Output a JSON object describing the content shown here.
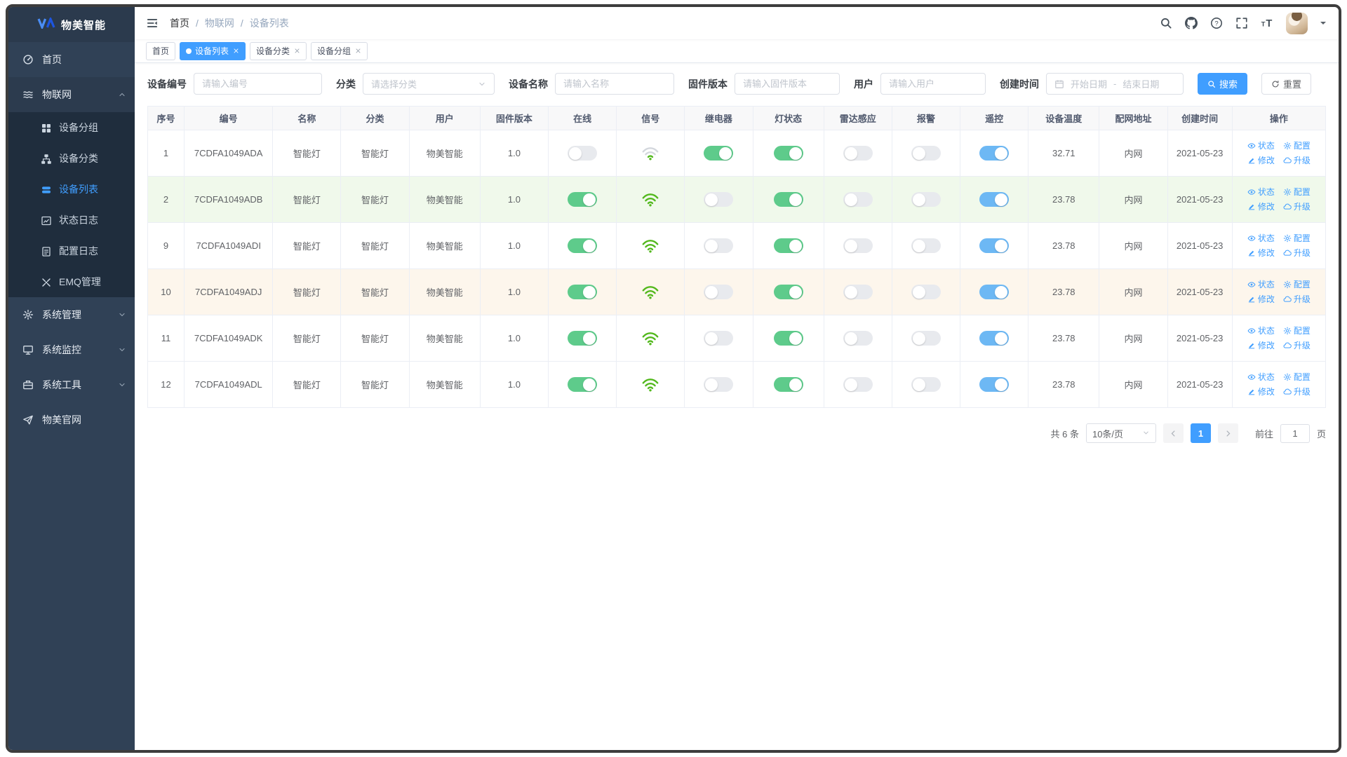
{
  "app": {
    "brand": "物美智能"
  },
  "colors": {
    "accent": "#409EFF",
    "toggle_green": "#5ecb8b",
    "toggle_blue": "#6db8f4",
    "wifi_green": "#52b81c",
    "row_green": "#f0f9eb",
    "row_orange": "#fdf6ec",
    "sidebar_bg": "#304156",
    "submenu_bg": "#1f2d3d"
  },
  "sidebar": {
    "items": [
      {
        "key": "home",
        "label": "首页",
        "icon": "dashboard-icon"
      },
      {
        "key": "iot",
        "label": "物联网",
        "icon": "iot-icon",
        "expanded": true,
        "children": [
          {
            "key": "device-group",
            "label": "设备分组",
            "icon": "group-icon"
          },
          {
            "key": "device-category",
            "label": "设备分类",
            "icon": "category-icon"
          },
          {
            "key": "device-list",
            "label": "设备列表",
            "icon": "list-icon",
            "active": true
          },
          {
            "key": "status-log",
            "label": "状态日志",
            "icon": "status-log-icon"
          },
          {
            "key": "config-log",
            "label": "配置日志",
            "icon": "config-log-icon"
          },
          {
            "key": "emq-manage",
            "label": "EMQ管理",
            "icon": "emq-icon"
          }
        ]
      },
      {
        "key": "system-manage",
        "label": "系统管理",
        "icon": "gear-icon",
        "collapsible": true
      },
      {
        "key": "system-monitor",
        "label": "系统监控",
        "icon": "monitor-icon",
        "collapsible": true
      },
      {
        "key": "system-tools",
        "label": "系统工具",
        "icon": "tools-icon",
        "collapsible": true
      },
      {
        "key": "official-site",
        "label": "物美官网",
        "icon": "site-icon"
      }
    ]
  },
  "navbar": {
    "breadcrumb": [
      "首页",
      "物联网",
      "设备列表"
    ]
  },
  "tabs": [
    {
      "label": "首页",
      "active": false,
      "closable": false
    },
    {
      "label": "设备列表",
      "active": true,
      "closable": true
    },
    {
      "label": "设备分类",
      "active": false,
      "closable": true
    },
    {
      "label": "设备分组",
      "active": false,
      "closable": true
    }
  ],
  "filters": {
    "device_no_label": "设备编号",
    "device_no_placeholder": "请输入编号",
    "category_label": "分类",
    "category_placeholder": "请选择分类",
    "name_label": "设备名称",
    "name_placeholder": "请输入名称",
    "firmware_label": "固件版本",
    "firmware_placeholder": "请输入固件版本",
    "user_label": "用户",
    "user_placeholder": "请输入用户",
    "created_label": "创建时间",
    "date_start_placeholder": "开始日期",
    "date_separator": "-",
    "date_end_placeholder": "结束日期",
    "search_label": "搜索",
    "reset_label": "重置"
  },
  "table": {
    "columns": [
      "序号",
      "编号",
      "名称",
      "分类",
      "用户",
      "固件版本",
      "在线",
      "信号",
      "继电器",
      "灯状态",
      "雷达感应",
      "报警",
      "遥控",
      "设备温度",
      "配网地址",
      "创建时间",
      "操作"
    ],
    "action_labels": {
      "status": "状态",
      "config": "配置",
      "edit": "修改",
      "upgrade": "升级"
    },
    "rows": [
      {
        "index": "1",
        "code": "7CDFA1049ADA",
        "name": "智能灯",
        "category": "智能灯",
        "user": "物美智能",
        "firmware": "1.0",
        "online": false,
        "signal": "weak",
        "relay": true,
        "light": true,
        "radar": false,
        "alarm": false,
        "remote": true,
        "temperature": "32.71",
        "network": "内网",
        "created": "2021-05-23",
        "highlight": "none"
      },
      {
        "index": "2",
        "code": "7CDFA1049ADB",
        "name": "智能灯",
        "category": "智能灯",
        "user": "物美智能",
        "firmware": "1.0",
        "online": true,
        "signal": "strong",
        "relay": false,
        "light": true,
        "radar": false,
        "alarm": false,
        "remote": true,
        "temperature": "23.78",
        "network": "内网",
        "created": "2021-05-23",
        "highlight": "green"
      },
      {
        "index": "9",
        "code": "7CDFA1049ADI",
        "name": "智能灯",
        "category": "智能灯",
        "user": "物美智能",
        "firmware": "1.0",
        "online": true,
        "signal": "strong",
        "relay": false,
        "light": true,
        "radar": false,
        "alarm": false,
        "remote": true,
        "temperature": "23.78",
        "network": "内网",
        "created": "2021-05-23",
        "highlight": "none"
      },
      {
        "index": "10",
        "code": "7CDFA1049ADJ",
        "name": "智能灯",
        "category": "智能灯",
        "user": "物美智能",
        "firmware": "1.0",
        "online": true,
        "signal": "strong",
        "relay": false,
        "light": true,
        "radar": false,
        "alarm": false,
        "remote": true,
        "temperature": "23.78",
        "network": "内网",
        "created": "2021-05-23",
        "highlight": "orange"
      },
      {
        "index": "11",
        "code": "7CDFA1049ADK",
        "name": "智能灯",
        "category": "智能灯",
        "user": "物美智能",
        "firmware": "1.0",
        "online": true,
        "signal": "strong",
        "relay": false,
        "light": true,
        "radar": false,
        "alarm": false,
        "remote": true,
        "temperature": "23.78",
        "network": "内网",
        "created": "2021-05-23",
        "highlight": "none"
      },
      {
        "index": "12",
        "code": "7CDFA1049ADL",
        "name": "智能灯",
        "category": "智能灯",
        "user": "物美智能",
        "firmware": "1.0",
        "online": true,
        "signal": "strong",
        "relay": false,
        "light": true,
        "radar": false,
        "alarm": false,
        "remote": true,
        "temperature": "23.78",
        "network": "内网",
        "created": "2021-05-23",
        "highlight": "none"
      }
    ]
  },
  "pagination": {
    "total_text": "共 6 条",
    "page_size": "10条/页",
    "current_page": "1",
    "goto_label": "前往",
    "goto_value": "1",
    "page_suffix": "页"
  }
}
